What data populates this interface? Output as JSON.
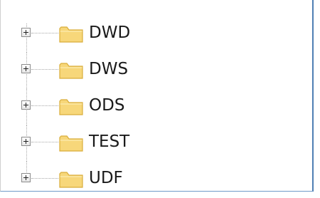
{
  "tree": {
    "nodes": [
      {
        "label": "DWD",
        "icon": "folder-icon",
        "expand_icon": "plus-expander-icon"
      },
      {
        "label": "DWS",
        "icon": "folder-icon",
        "expand_icon": "plus-expander-icon"
      },
      {
        "label": "ODS",
        "icon": "folder-icon",
        "expand_icon": "plus-expander-icon"
      },
      {
        "label": "TEST",
        "icon": "folder-icon",
        "expand_icon": "plus-expander-icon"
      },
      {
        "label": "UDF",
        "icon": "folder-icon",
        "expand_icon": "plus-expander-icon"
      }
    ]
  },
  "colors": {
    "folder_fill": "#f7d77a",
    "folder_stroke": "#d9ad3a",
    "panel_border": "#4f7fb4",
    "text": "#1a1a1a"
  }
}
